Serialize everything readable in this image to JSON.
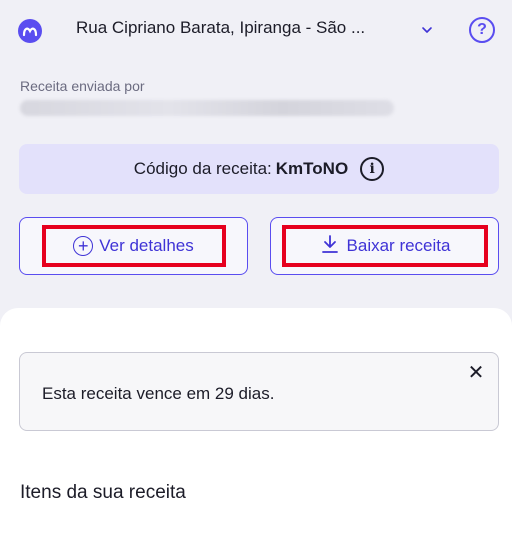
{
  "header": {
    "address": "Rua Cipriano Barata, Ipiranga - São ...",
    "help_label": "?"
  },
  "prescription": {
    "sent_by_label": "Receita enviada por",
    "code_label": "Código da receita:",
    "code_value": "KmToNO",
    "info_glyph": "i"
  },
  "actions": {
    "details_label": "Ver detalhes",
    "download_label": "Baixar receita"
  },
  "notice": {
    "text": "Esta receita vence em 29 dias.",
    "close_glyph": "✕"
  },
  "items_section": {
    "title": "Itens da sua receita"
  },
  "colors": {
    "brand": "#5a4df0",
    "link": "#3f33d6",
    "highlight_box": "#e6001e",
    "code_bg": "#e3e1fb"
  }
}
